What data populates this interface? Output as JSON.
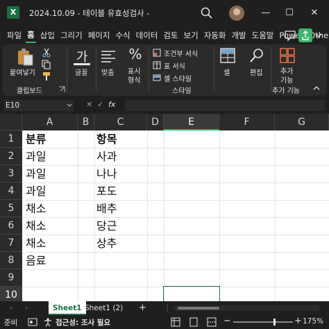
{
  "titlebar": {
    "logo_letter": "X",
    "title": "2024.10.09 - 테이블 유효성검사 -",
    "icons": [
      "search-icon",
      "avatar",
      "minimize-icon",
      "maximize-icon",
      "close-icon"
    ],
    "minimize_glyph": "—",
    "maximize_glyph": "☐",
    "close_glyph": "✕"
  },
  "ribbon_tabs": [
    "파일",
    "홈",
    "삽입",
    "그리기",
    "페이지",
    "수식",
    "데이터",
    "검토",
    "보기",
    "자동화",
    "개발",
    "도움말",
    "Power",
    "Other"
  ],
  "ribbon_active_tab": "홈",
  "ribbon": {
    "paste_label": "붙여넣기",
    "clipboard_group": "클립보드",
    "font_label": "글꼴",
    "font_icon_glyph": "가",
    "align_label": "맞춤",
    "number_label_1": "표시",
    "number_label_2": "형식",
    "number_icon_glyph": "%",
    "cond_format": "조건부 서식",
    "table_format": "표 서식",
    "cell_style": "셀 스타일",
    "styles_group": "스타일",
    "cells_label": "셀",
    "edit_label": "편집",
    "addin_label_1": "추가",
    "addin_label_2": "기능",
    "addin_group": "추가 기능",
    "accent_color": "#3fb56b"
  },
  "formula_bar": {
    "name_box": "E10",
    "cancel_glyph": "✕",
    "enter_glyph": "✓",
    "fx_glyph": "fx",
    "formula": ""
  },
  "sheet": {
    "columns": [
      "A",
      "B",
      "C",
      "D",
      "E",
      "F",
      "G"
    ],
    "selected_column": "E",
    "rows": [
      "1",
      "2",
      "3",
      "4",
      "5",
      "6",
      "7",
      "8",
      "9",
      "10"
    ],
    "selected_row": "10",
    "cells": {
      "A1": "분류",
      "C1": "항목",
      "A2": "과일",
      "C2": "사과",
      "A3": "과일",
      "C3": "나나",
      "A4": "과일",
      "C4": "포도",
      "A5": "채소",
      "C5": "배추",
      "A6": "채소",
      "C6": "당근",
      "A7": "채소",
      "C7": "상추",
      "A8": "음료"
    }
  },
  "sheet_tabs": {
    "prev_glyph": "‹",
    "next_glyph": "›",
    "tabs": [
      "Sheet1",
      "Sheet1 (2)"
    ],
    "active": "Sheet1",
    "add_glyph": "+",
    "more_glyph": "⋮"
  },
  "status_bar": {
    "ready": "준비",
    "accessibility": "접근성: 조사 필요",
    "minus_glyph": "−",
    "plus_glyph": "+",
    "zoom": "175%"
  }
}
